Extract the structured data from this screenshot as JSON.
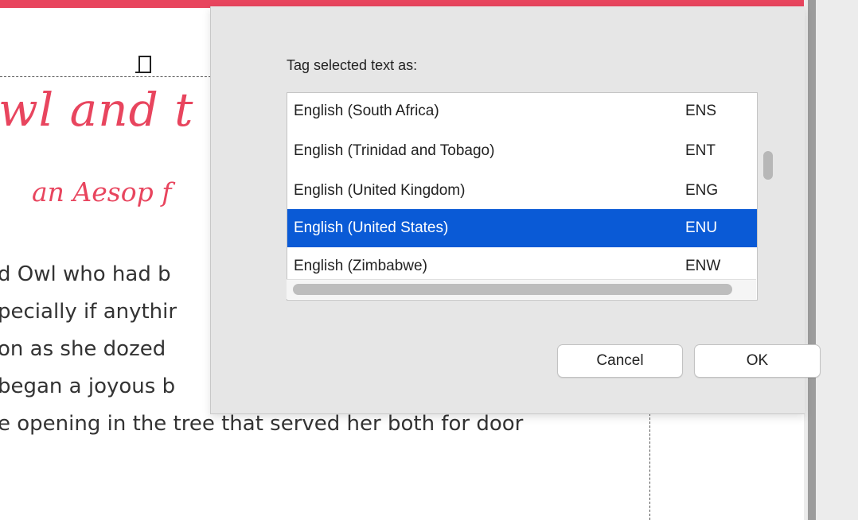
{
  "document": {
    "title_fragment": "wl and t",
    "subtitle_fragment": "an Aesop f",
    "lines": [
      "d Owl who had b",
      "pecially if anythir",
      "on as she dozed",
      " began a joyous b",
      "e opening in the tree that served her both for door"
    ]
  },
  "dialog": {
    "prompt": "Tag selected text as:",
    "languages": [
      {
        "name": "English (South Africa)",
        "code": "ENS",
        "selected": false
      },
      {
        "name": "English (Trinidad and Tobago)",
        "code": "ENT",
        "selected": false
      },
      {
        "name": "English (United Kingdom)",
        "code": "ENG",
        "selected": false
      },
      {
        "name": "English (United States)",
        "code": "ENU",
        "selected": true
      },
      {
        "name": "English (Zimbabwe)",
        "code": "ENW",
        "selected": false
      }
    ],
    "cancel_label": "Cancel",
    "ok_label": "OK"
  },
  "colors": {
    "accent_red": "#e8455e",
    "selection_blue": "#0a5ad6"
  }
}
